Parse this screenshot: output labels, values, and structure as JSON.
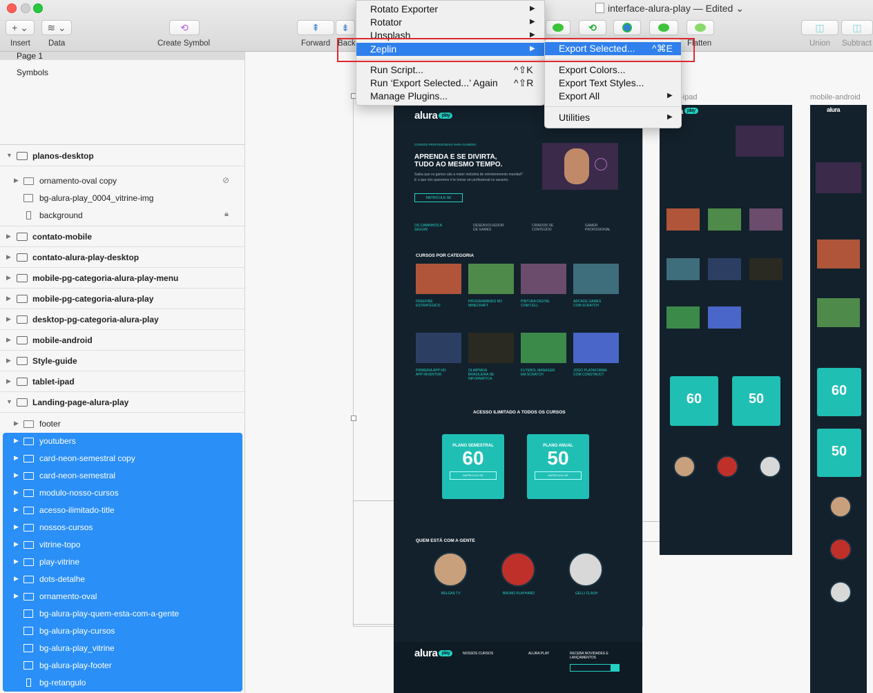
{
  "window": {
    "title": "interface-alura-play",
    "status": "— Edited"
  },
  "toolbar": {
    "insert_label": "Insert",
    "data_label": "Data",
    "create_symbol_label": "Create Symbol",
    "forward_label": "Forward",
    "backward_label": "Back",
    "flatten_label": "Flatten",
    "union_label": "Union",
    "subtract_label": "Subtract"
  },
  "sidebar": {
    "pages": [
      "Page 1",
      "Symbols"
    ],
    "layers": [
      {
        "name": "planos-desktop",
        "type": "artboard",
        "expanded": true
      },
      {
        "name": "ornamento-oval copy",
        "type": "folder"
      },
      {
        "name": "bg-alura-play_0004_vitrine-img",
        "type": "image"
      },
      {
        "name": "background",
        "type": "rect"
      },
      {
        "name": "contato-mobile",
        "type": "artboard"
      },
      {
        "name": "contato-alura-play-desktop",
        "type": "artboard"
      },
      {
        "name": "mobile-pg-categoria-alura-play-menu",
        "type": "artboard"
      },
      {
        "name": "mobile-pg-categoria-alura-play",
        "type": "artboard"
      },
      {
        "name": "desktop-pg-categoria-alura-play",
        "type": "artboard"
      },
      {
        "name": "mobile-android",
        "type": "artboard"
      },
      {
        "name": "Style-guide",
        "type": "artboard"
      },
      {
        "name": "tablet-ipad",
        "type": "artboard"
      },
      {
        "name": "Landing-page-alura-play",
        "type": "artboard",
        "expanded": true
      },
      {
        "name": "footer",
        "type": "folder"
      }
    ],
    "selected": [
      {
        "name": "youtubers",
        "type": "folder"
      },
      {
        "name": "card-neon-semestral copy",
        "type": "folder"
      },
      {
        "name": "card-neon-semestral",
        "type": "folder"
      },
      {
        "name": "modulo-nosso-cursos",
        "type": "folder"
      },
      {
        "name": "acesso-ilimitado-title",
        "type": "folder"
      },
      {
        "name": "nossos-cursos",
        "type": "folder"
      },
      {
        "name": "vitrine-topo",
        "type": "folder"
      },
      {
        "name": "play-vitrine",
        "type": "folder"
      },
      {
        "name": "dots-detalhe",
        "type": "folder"
      },
      {
        "name": "ornamento-oval",
        "type": "folder"
      },
      {
        "name": "bg-alura-play-quem-esta-com-a-gente",
        "type": "image"
      },
      {
        "name": "bg-alura-play-cursos",
        "type": "image"
      },
      {
        "name": "bg-alura-play_vitrine",
        "type": "image"
      },
      {
        "name": "bg-alura-play-footer",
        "type": "image"
      },
      {
        "name": "bg-retangulo",
        "type": "rect"
      }
    ]
  },
  "plugins_menu": {
    "items": [
      {
        "label": "Rotato Exporter",
        "submenu": true
      },
      {
        "label": "Rotator",
        "submenu": true
      },
      {
        "label": "Unsplash",
        "submenu": true
      },
      {
        "label": "Zeplin",
        "submenu": true,
        "highlighted": true
      },
      {
        "label": "Run Script...",
        "shortcut": "^⇧K"
      },
      {
        "label": "Run ‘Export Selected...’ Again",
        "shortcut": "^⇧R"
      },
      {
        "label": "Manage Plugins..."
      }
    ]
  },
  "zeplin_menu": {
    "items": [
      {
        "label": "Export Selected...",
        "shortcut": "^⌘E",
        "highlighted": true
      },
      {
        "label": "Export Colors..."
      },
      {
        "label": "Export Text Styles..."
      },
      {
        "label": "Export All",
        "submenu": true
      },
      {
        "label": "Utilities",
        "submenu": true
      }
    ]
  },
  "canvas": {
    "artboard_labels": [
      "tablet-ipad",
      "mobile-android"
    ],
    "desktop": {
      "logo": "alura",
      "logo_badge": "play",
      "tagline": "CURSOS PROFISSIONAIS PARA GAMERS",
      "hero_title_1": "APRENDA E SE DIVIRTA,",
      "hero_title_2": "TUDO AO MESMO TEMPO.",
      "hero_text_1": "Saiba que os games são a maior indústria de entretenimento mundial?",
      "hero_text_2": "E o que nós queremos é te tornar um profissional no assunto.",
      "cta": "MATRICULE-SE",
      "features": [
        "OS CAMINHOS A SEGUIR",
        "DESENVOLVEDOR DE GAMES",
        "CRIADOR DE CONTEÚDO",
        "GAMER PROFISSIONAL"
      ],
      "courses_title": "CURSOS POR CATEGORIA",
      "courses": [
        "FREEFIRE ESTRATÉGICO",
        "PROGRAMANDO NO MINECRAFT",
        "PINTURA DIGITAL COM CELL",
        "ARCADE GAMES COM SCRATCH",
        "PRIMEIRA APP NO APP INVENTOR",
        "OLIMPÍADA BRASILEIRA DE INFORMÁTICA",
        "FUTEBOL MANAGER EM SCRATCH",
        "JOGO PLATAFORMA COM CONSTRUCT"
      ],
      "access_title": "ACESSO ILIMITADO A TODOS OS CURSOS",
      "plans": [
        {
          "name": "PLANO SEMESTRAL",
          "price": "60"
        },
        {
          "name": "PLANO ANUAL",
          "price": "50"
        }
      ],
      "plan_button": "MATRICULE-SE",
      "people_title": "QUEM ESTÁ COM A GENTE",
      "people": [
        "BELGAS TV",
        "BRUNO PLAYHARD",
        "GELLI CLASH"
      ],
      "footer_cols": [
        "NOSSOS CURSOS",
        "ALURA PLAY",
        "RECEBA NOVIDADES E LANÇAMENTOS"
      ]
    }
  }
}
